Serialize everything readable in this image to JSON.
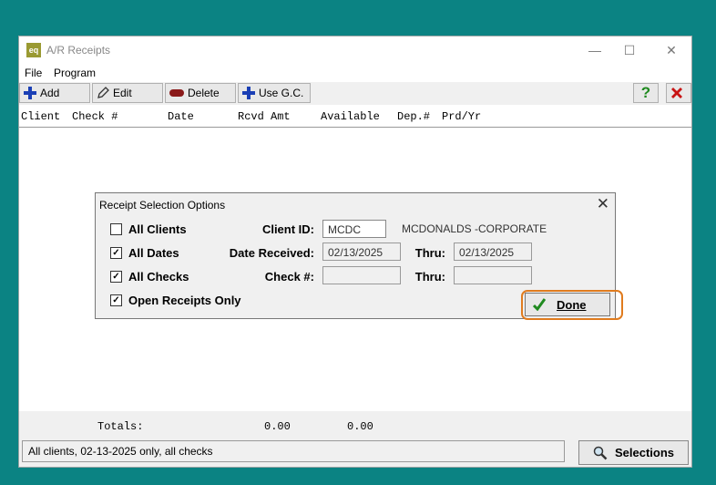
{
  "window": {
    "title": "A/R Receipts",
    "app_icon_text": "eq"
  },
  "menu": [
    "File",
    "Program"
  ],
  "toolbar": {
    "add": "Add",
    "edit": "Edit",
    "delete": "Delete",
    "use_gc": "Use G.C."
  },
  "columns": [
    "Client",
    "Check #",
    "Date",
    "Rcvd Amt",
    "Available",
    "Dep.#",
    "Prd/Yr"
  ],
  "totals": {
    "label": "Totals:",
    "rcvd": "0.00",
    "available": "0.00"
  },
  "status": "All clients, 02-13-2025 only, all checks",
  "selections_label": "Selections",
  "dialog": {
    "title": "Receipt Selection Options",
    "all_clients": {
      "label": "All Clients",
      "checked": false
    },
    "all_dates": {
      "label": "All Dates",
      "checked": true
    },
    "all_checks": {
      "label": "All Checks",
      "checked": true
    },
    "open_only": {
      "label": "Open Receipts Only",
      "checked": true
    },
    "client_id_label": "Client ID:",
    "client_id_value": "MCDC",
    "client_name": "MCDONALDS -CORPORATE",
    "date_received_label": "Date Received:",
    "date_from": "02/13/2025",
    "thru_label": "Thru:",
    "date_thru": "02/13/2025",
    "check_label": "Check #:",
    "check_from": "",
    "check_thru": "",
    "done_label": "Done"
  },
  "colors": {
    "background": "#0b8383",
    "highlight": "#e07b1e",
    "accent_blue": "#1a3fb5",
    "close_red": "#c81414",
    "help_green": "#1f8a1f"
  }
}
